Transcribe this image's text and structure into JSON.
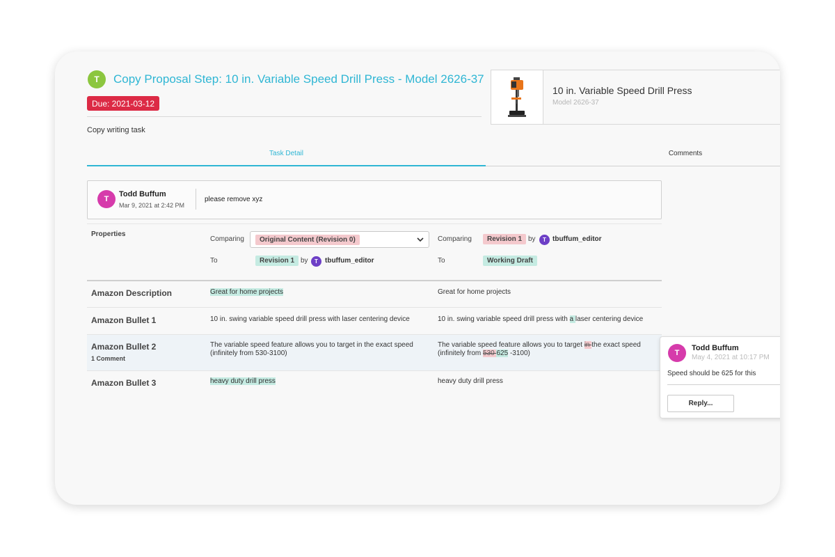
{
  "task": {
    "assignee_initial": "T",
    "title": "Copy Proposal Step: 10 in. Variable Speed Drill Press - Model 2626-37",
    "due": "Due: 2021-03-12",
    "type": "Copy writing task"
  },
  "product": {
    "name": "10 in. Variable Speed Drill Press",
    "model": "Model 2626-37"
  },
  "tabs": [
    {
      "label": "Task Detail",
      "active": true
    },
    {
      "label": "Comments",
      "active": false
    }
  ],
  "note": {
    "initial": "T",
    "author": "Todd Buffum",
    "time": "Mar 9, 2021 at 2:42 PM",
    "text": "please remove xyz"
  },
  "properties": {
    "label": "Properties",
    "left": {
      "comparing_label": "Comparing",
      "comparing_value": "Original Content (Revision 0)",
      "to_label": "To",
      "to_value": "Revision 1",
      "by": "by",
      "user_initial": "T",
      "user": "tbuffum_editor"
    },
    "right": {
      "comparing_label": "Comparing",
      "comparing_value": "Revision 1",
      "by": "by",
      "user_initial": "T",
      "user": "tbuffum_editor",
      "to_label": "To",
      "to_value": "Working Draft"
    }
  },
  "rows": [
    {
      "label": "Amazon Description",
      "left": "Great for home projects",
      "right": "Great for home projects"
    },
    {
      "label": "Amazon Bullet 1",
      "left": "10 in. swing variable speed drill press with laser centering device",
      "right_pre": "10 in. swing variable speed drill press with ",
      "right_added": "a ",
      "right_post": "laser centering device"
    },
    {
      "label": "Amazon Bullet 2",
      "sub": "1 Comment",
      "left_line1": "The variable speed feature allows you to target in the exact speed",
      "left_line2": "(infinitely from 530-3100)",
      "right_pre": "The variable speed feature allows you to target ",
      "right_removed": "in ",
      "right_post": "the exact speed",
      "right_line2_pre": "(infinitely from ",
      "right_line2_removed": "530 ",
      "right_line2_added": "625",
      "right_line2_post": " -3100)"
    },
    {
      "label": "Amazon Bullet 3",
      "left": "heavy duty drill press",
      "right": "heavy duty drill press"
    }
  ],
  "comment": {
    "initial": "T",
    "author": "Todd Buffum",
    "time": "May 4, 2021 at 10:17 PM",
    "text": "Speed should be 625 for this",
    "reply_label": "Reply..."
  },
  "colors": {
    "accent": "#2fb6d4",
    "due": "#dc2a45",
    "added": "#c5ebe2",
    "removed": "#f4c9cd",
    "avatar_green": "#8cc63f",
    "avatar_pink": "#d63bab",
    "avatar_purple": "#6d3fc6"
  }
}
